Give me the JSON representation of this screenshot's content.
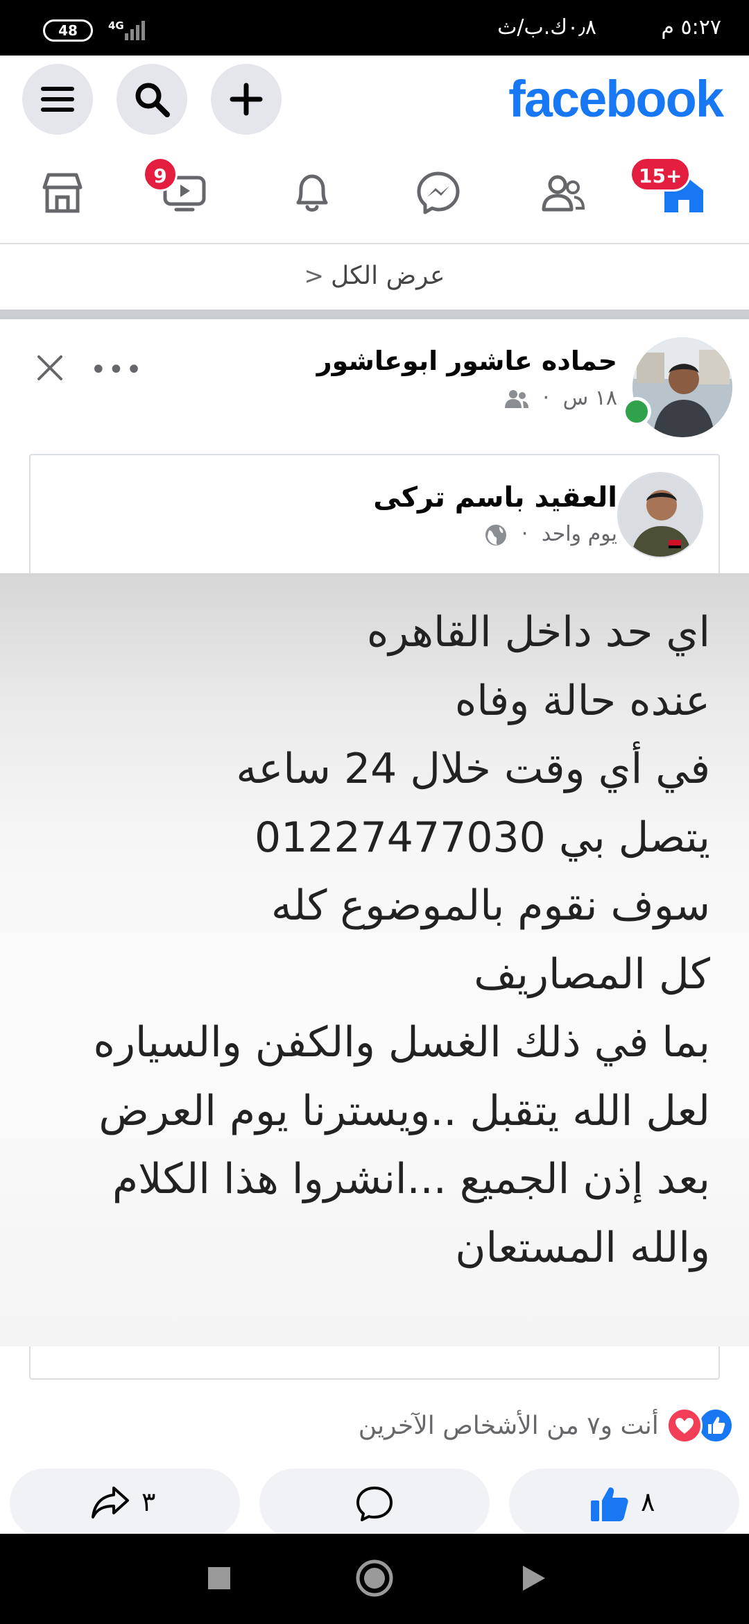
{
  "status_bar": {
    "time": "٥:٢٧ م",
    "network_speed": "٠٫٨ك.ب/ث",
    "battery": "48",
    "network_type": "4G"
  },
  "header": {
    "logo": "facebook"
  },
  "nav": {
    "video_badge": "9",
    "home_badge": "15+"
  },
  "see_all": {
    "label": "عرض الكل",
    "chevron": "<"
  },
  "post": {
    "author": "حماده عاشور ابوعاشور",
    "time": "١٨ س",
    "separator": "·",
    "more": "•••"
  },
  "shared_post": {
    "author": "العقيد باسم تركى",
    "time": "يوم واحد",
    "separator": "·",
    "lines": [
      "اي حد داخل القاهره",
      "عنده حالة وفاه",
      "في أي وقت خلال 24 ساعه",
      "يتصل بي 01227477030",
      "سوف نقوم بالموضوع كله",
      "كل المصاريف",
      "بما في ذلك الغسل والكفن والسياره",
      "لعل الله يتقبل ..ويسترنا يوم العرض",
      "بعد إذن الجميع ...انشروا هذا الكلام",
      "والله المستعان"
    ]
  },
  "reactions": {
    "summary": "أنت و٧ من الأشخاص الآخرين"
  },
  "actions": {
    "like_count": "٨",
    "share_count": "٣"
  },
  "colors": {
    "brand": "#1877f2",
    "badge": "#e41e3f",
    "love": "#f33e58",
    "online": "#31a24c"
  }
}
